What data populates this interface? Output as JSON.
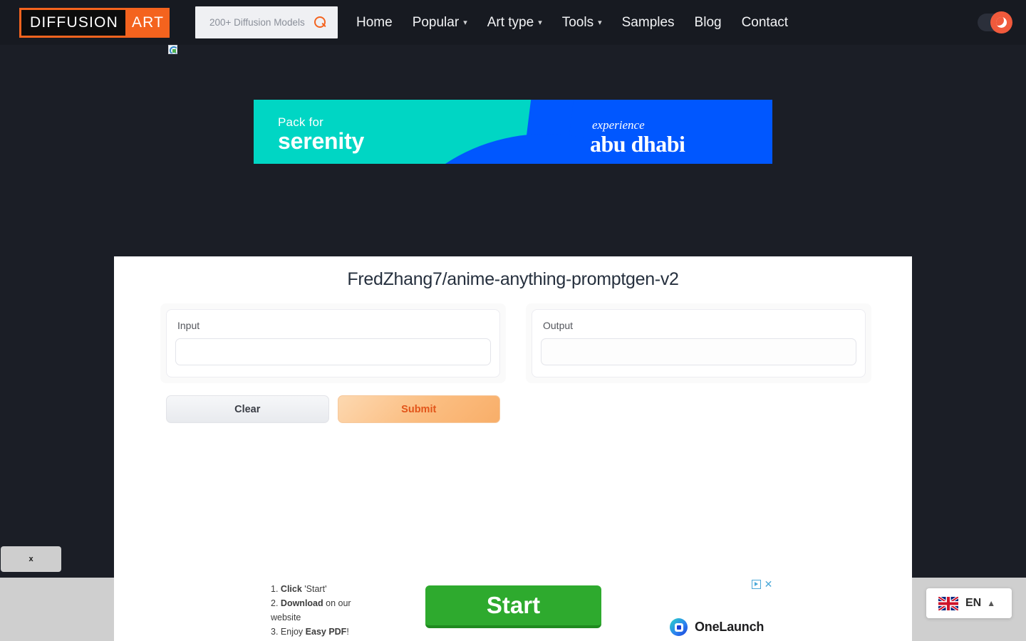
{
  "header": {
    "logo": {
      "part1": "DIFFUSION",
      "part2": "ART"
    },
    "search": {
      "placeholder": "200+ Diffusion Models",
      "icon": "search-icon"
    },
    "nav": [
      {
        "label": "Home",
        "has_chevron": false
      },
      {
        "label": "Popular",
        "has_chevron": true
      },
      {
        "label": "Art type",
        "has_chevron": true
      },
      {
        "label": "Tools",
        "has_chevron": true
      },
      {
        "label": "Samples",
        "has_chevron": false
      },
      {
        "label": "Blog",
        "has_chevron": false
      },
      {
        "label": "Contact",
        "has_chevron": false
      }
    ],
    "theme_toggle": {
      "icon": "moon-icon",
      "state": "dark",
      "accent": "#f05a3c"
    }
  },
  "banner_ad": {
    "left_small": "Pack for",
    "left_big": "serenity",
    "right_small": "experience",
    "right_big": "abu dhabi",
    "colors": {
      "teal": "#00d6c4",
      "blue": "#0057ff"
    }
  },
  "main": {
    "title": "FredZhang7/anime-anything-promptgen-v2",
    "input": {
      "label": "Input",
      "value": "",
      "placeholder": ""
    },
    "output": {
      "label": "Output",
      "value": "",
      "placeholder": ""
    },
    "buttons": {
      "clear": "Clear",
      "submit": "Submit"
    }
  },
  "bottom_ad": {
    "steps": [
      {
        "num": "1.",
        "bold": "Click",
        "rest": " 'Start'"
      },
      {
        "num": "2.",
        "bold": "Download",
        "rest": " on our website"
      },
      {
        "num": "3.",
        "pre": " Enjoy ",
        "bold": "Easy PDF",
        "rest": "!"
      }
    ],
    "cta": "Start",
    "brand": "OneLaunch",
    "adchoices_icon": "adchoices-icon",
    "close_icon": "close-icon"
  },
  "overlay_close": {
    "label": "x"
  },
  "language": {
    "code": "EN",
    "flag": "uk-flag-icon",
    "chevron": "chevron-up-icon"
  }
}
